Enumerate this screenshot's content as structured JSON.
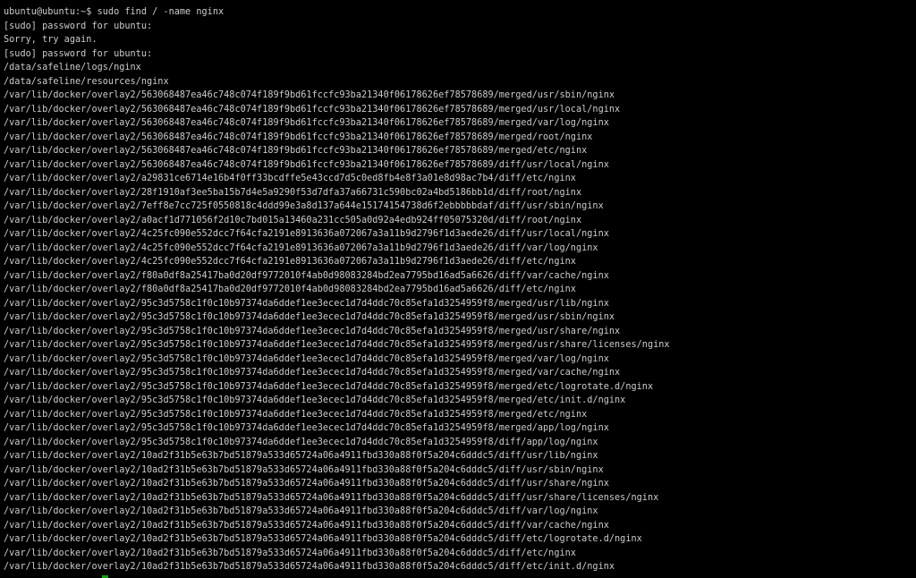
{
  "terminal": {
    "colors": {
      "background": "#000000",
      "foreground": "#cccccc",
      "cursor": "#13a10e"
    },
    "lines": [
      "ubuntu@ubuntu:~$ sudo find / -name nginx",
      "[sudo] password for ubuntu:",
      "Sorry, try again.",
      "[sudo] password for ubuntu:",
      "/data/safeline/logs/nginx",
      "/data/safeline/resources/nginx",
      "/var/lib/docker/overlay2/563068487ea46c748c074f189f9bd61fccfc93ba21340f06178626ef78578689/merged/usr/sbin/nginx",
      "/var/lib/docker/overlay2/563068487ea46c748c074f189f9bd61fccfc93ba21340f06178626ef78578689/merged/usr/local/nginx",
      "/var/lib/docker/overlay2/563068487ea46c748c074f189f9bd61fccfc93ba21340f06178626ef78578689/merged/var/log/nginx",
      "/var/lib/docker/overlay2/563068487ea46c748c074f189f9bd61fccfc93ba21340f06178626ef78578689/merged/root/nginx",
      "/var/lib/docker/overlay2/563068487ea46c748c074f189f9bd61fccfc93ba21340f06178626ef78578689/merged/etc/nginx",
      "/var/lib/docker/overlay2/563068487ea46c748c074f189f9bd61fccfc93ba21340f06178626ef78578689/diff/usr/local/nginx",
      "/var/lib/docker/overlay2/a29831ce6714e16b4f0ff33bcdffe5e43ccd7d5c0ed8fb4e8f3a01e8d98ac7b4/diff/etc/nginx",
      "/var/lib/docker/overlay2/28f1910af3ee5ba15b7d4e5a9290f53d7dfa37a66731c590bc02a4bd5186bb1d/diff/root/nginx",
      "/var/lib/docker/overlay2/7eff8e7cc725f0550818c4ddd99e3a8d137a644e15174154738d6f2ebbbbbdaf/diff/usr/sbin/nginx",
      "/var/lib/docker/overlay2/a0acf1d771056f2d10c7bd015a13460a231cc505a0d92a4edb924ff05075320d/diff/root/nginx",
      "/var/lib/docker/overlay2/4c25fc090e552dcc7f64cfa2191e8913636a072067a3a11b9d2796f1d3aede26/diff/usr/local/nginx",
      "/var/lib/docker/overlay2/4c25fc090e552dcc7f64cfa2191e8913636a072067a3a11b9d2796f1d3aede26/diff/var/log/nginx",
      "/var/lib/docker/overlay2/4c25fc090e552dcc7f64cfa2191e8913636a072067a3a11b9d2796f1d3aede26/diff/etc/nginx",
      "/var/lib/docker/overlay2/f80a0df8a25417ba0d20df9772010f4ab0d98083284bd2ea7795bd16ad5a6626/diff/var/cache/nginx",
      "/var/lib/docker/overlay2/f80a0df8a25417ba0d20df9772010f4ab0d98083284bd2ea7795bd16ad5a6626/diff/etc/nginx",
      "/var/lib/docker/overlay2/95c3d5758c1f0c10b97374da6ddef1ee3ecec1d7d4ddc70c85efa1d3254959f8/merged/usr/lib/nginx",
      "/var/lib/docker/overlay2/95c3d5758c1f0c10b97374da6ddef1ee3ecec1d7d4ddc70c85efa1d3254959f8/merged/usr/sbin/nginx",
      "/var/lib/docker/overlay2/95c3d5758c1f0c10b97374da6ddef1ee3ecec1d7d4ddc70c85efa1d3254959f8/merged/usr/share/nginx",
      "/var/lib/docker/overlay2/95c3d5758c1f0c10b97374da6ddef1ee3ecec1d7d4ddc70c85efa1d3254959f8/merged/usr/share/licenses/nginx",
      "/var/lib/docker/overlay2/95c3d5758c1f0c10b97374da6ddef1ee3ecec1d7d4ddc70c85efa1d3254959f8/merged/var/log/nginx",
      "/var/lib/docker/overlay2/95c3d5758c1f0c10b97374da6ddef1ee3ecec1d7d4ddc70c85efa1d3254959f8/merged/var/cache/nginx",
      "/var/lib/docker/overlay2/95c3d5758c1f0c10b97374da6ddef1ee3ecec1d7d4ddc70c85efa1d3254959f8/merged/etc/logrotate.d/nginx",
      "/var/lib/docker/overlay2/95c3d5758c1f0c10b97374da6ddef1ee3ecec1d7d4ddc70c85efa1d3254959f8/merged/etc/init.d/nginx",
      "/var/lib/docker/overlay2/95c3d5758c1f0c10b97374da6ddef1ee3ecec1d7d4ddc70c85efa1d3254959f8/merged/etc/nginx",
      "/var/lib/docker/overlay2/95c3d5758c1f0c10b97374da6ddef1ee3ecec1d7d4ddc70c85efa1d3254959f8/merged/app/log/nginx",
      "/var/lib/docker/overlay2/95c3d5758c1f0c10b97374da6ddef1ee3ecec1d7d4ddc70c85efa1d3254959f8/diff/app/log/nginx",
      "/var/lib/docker/overlay2/10ad2f31b5e63b7bd51879a533d65724a06a4911fbd330a88f0f5a204c6dddc5/diff/usr/lib/nginx",
      "/var/lib/docker/overlay2/10ad2f31b5e63b7bd51879a533d65724a06a4911fbd330a88f0f5a204c6dddc5/diff/usr/sbin/nginx",
      "/var/lib/docker/overlay2/10ad2f31b5e63b7bd51879a533d65724a06a4911fbd330a88f0f5a204c6dddc5/diff/usr/share/nginx",
      "/var/lib/docker/overlay2/10ad2f31b5e63b7bd51879a533d65724a06a4911fbd330a88f0f5a204c6dddc5/diff/usr/share/licenses/nginx",
      "/var/lib/docker/overlay2/10ad2f31b5e63b7bd51879a533d65724a06a4911fbd330a88f0f5a204c6dddc5/diff/var/log/nginx",
      "/var/lib/docker/overlay2/10ad2f31b5e63b7bd51879a533d65724a06a4911fbd330a88f0f5a204c6dddc5/diff/var/cache/nginx",
      "/var/lib/docker/overlay2/10ad2f31b5e63b7bd51879a533d65724a06a4911fbd330a88f0f5a204c6dddc5/diff/etc/logrotate.d/nginx",
      "/var/lib/docker/overlay2/10ad2f31b5e63b7bd51879a533d65724a06a4911fbd330a88f0f5a204c6dddc5/diff/etc/nginx",
      "/var/lib/docker/overlay2/10ad2f31b5e63b7bd51879a533d65724a06a4911fbd330a88f0f5a204c6dddc5/diff/etc/init.d/nginx"
    ]
  }
}
